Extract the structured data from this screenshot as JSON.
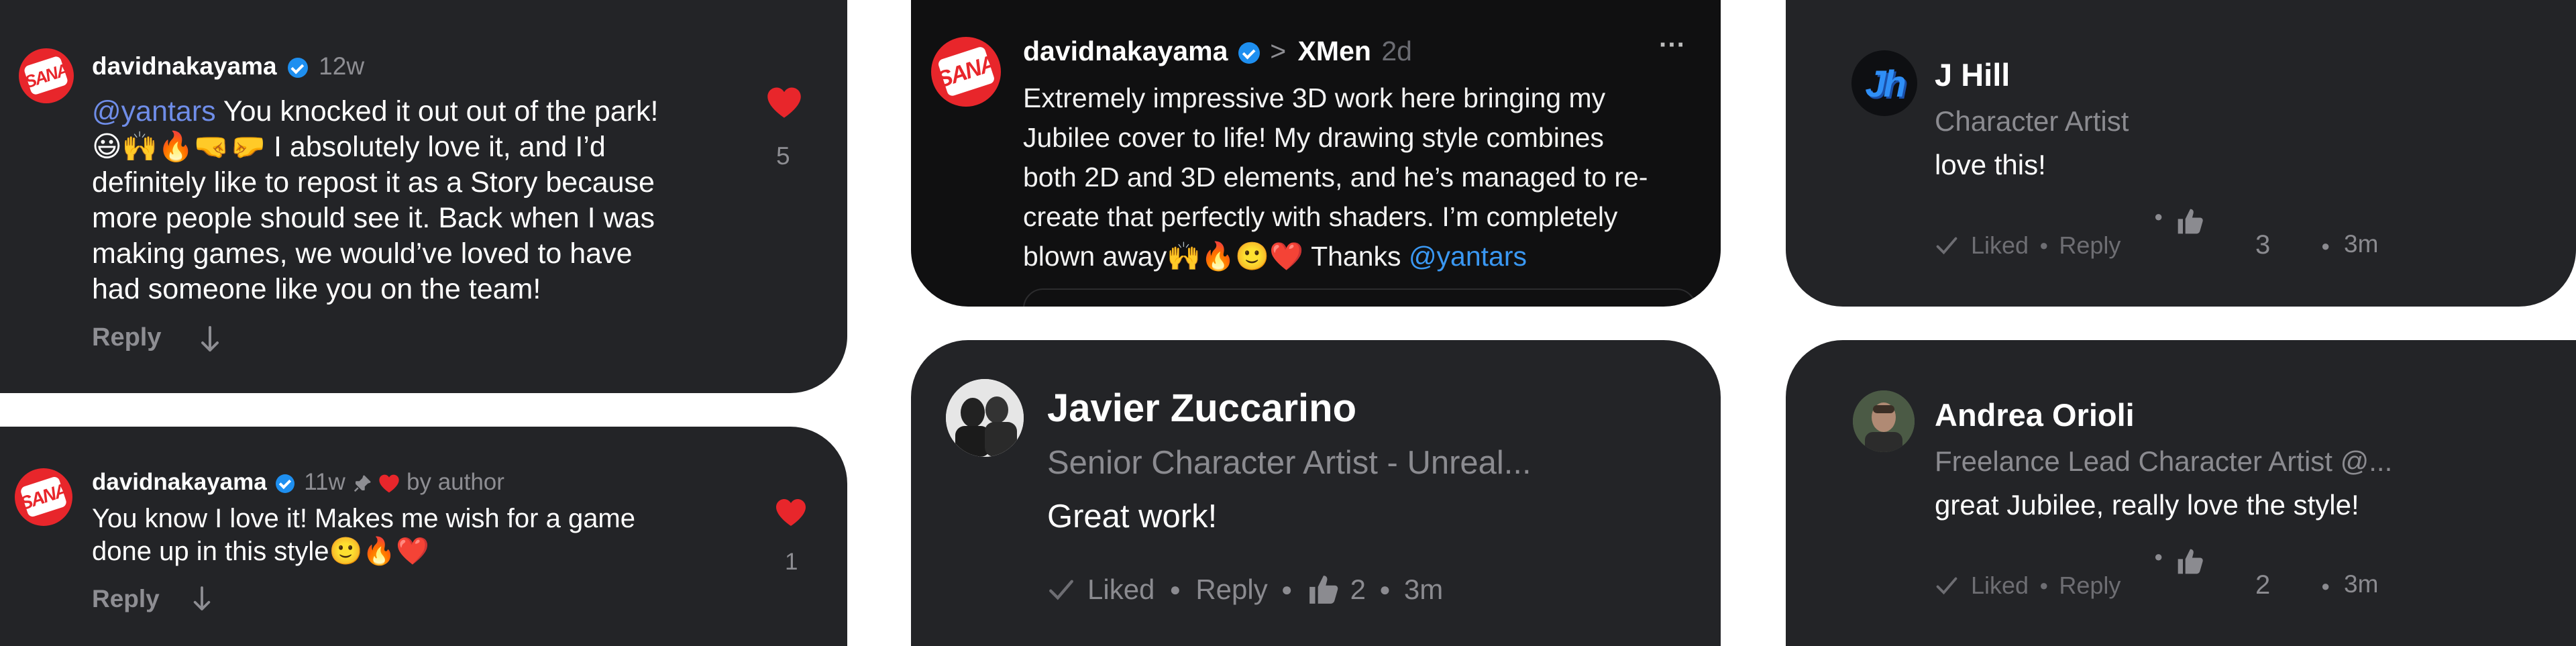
{
  "comment1": {
    "username": "davidnakayama",
    "time": "12w",
    "mention": "@yantars",
    "line1": " You knocked it out out of the park!",
    "line2_emoji": "😃🙌🔥🤜🤛",
    "line2": " I absolutely love it, and I’d",
    "line3": "definitely like to repost it as a Story because",
    "line4": "more people should see it. Back when I was",
    "line5": "making games, we would’ve loved to have",
    "line6": "had someone like you on the team!",
    "reply_label": "Reply",
    "like_count": "5",
    "logo_text": "SANA"
  },
  "comment2": {
    "username": "davidnakayama",
    "time": "11w",
    "by_author": "by author",
    "line1": "You know I love it! Makes me wish for a game",
    "line2": "done up in this style",
    "line2_emoji": "🙂🔥❤️",
    "reply_label": "Reply",
    "like_count": "1",
    "logo_text": "SANA"
  },
  "post": {
    "username": "davidnakayama",
    "separator": ">",
    "group": "XMen",
    "time": "2d",
    "more": "···",
    "line1": "Extremely impressive 3D work here bringing my",
    "line2": "Jubilee cover to life!  My drawing style combines",
    "line3": "both 2D and 3D elements, and he’s managed to re-",
    "line4": "create that perfectly with shaders. I’m completely",
    "line5a": "blown away",
    "line5_emoji": "🙌🔥🙂❤️",
    "line5b": " Thanks ",
    "mention": "@yantars",
    "logo_text": "SANA"
  },
  "javier": {
    "name": "Javier Zuccarino",
    "title": "Senior Character Artist - Unreal...",
    "text": "Great work!",
    "liked": "Liked",
    "reply": "Reply",
    "likes": "2",
    "time": "3m"
  },
  "jhill": {
    "name": "J Hill",
    "title": "Character Artist",
    "text": "love this!",
    "liked": "Liked",
    "reply": "Reply",
    "likes": "3",
    "time": "3m",
    "avatar_text": "Jh"
  },
  "andrea": {
    "name": "Andrea Orioli",
    "title": "Freelance Lead Character Artist @...",
    "text": "great Jubilee, really love the style!",
    "liked": "Liked",
    "reply": "Reply",
    "likes": "2",
    "time": "3m"
  },
  "colors": {
    "heart": "#e8262b",
    "verified": "#1e8ff0",
    "mention": "#6f8de8",
    "card_grey": "#232427",
    "card_black": "#101011"
  },
  "icons": [
    "heart-icon",
    "verified-badge-icon",
    "pin-icon",
    "reply-arrow-icon",
    "more-icon",
    "chevron-right-icon",
    "check-icon",
    "thumbs-up-icon"
  ]
}
